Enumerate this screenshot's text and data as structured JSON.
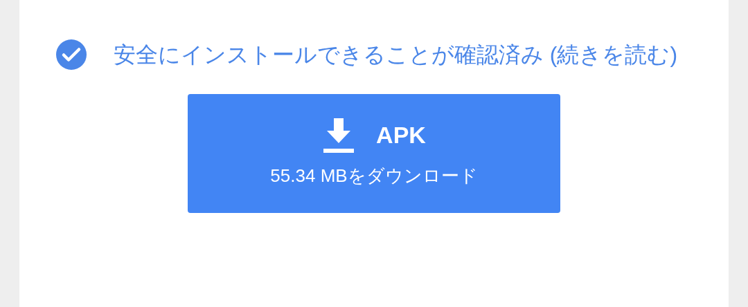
{
  "verification": {
    "text": "安全にインストールできることが確認済み (続きを読む)"
  },
  "download_button": {
    "title": "APK",
    "subtitle": "55.34 MBをダウンロード"
  }
}
